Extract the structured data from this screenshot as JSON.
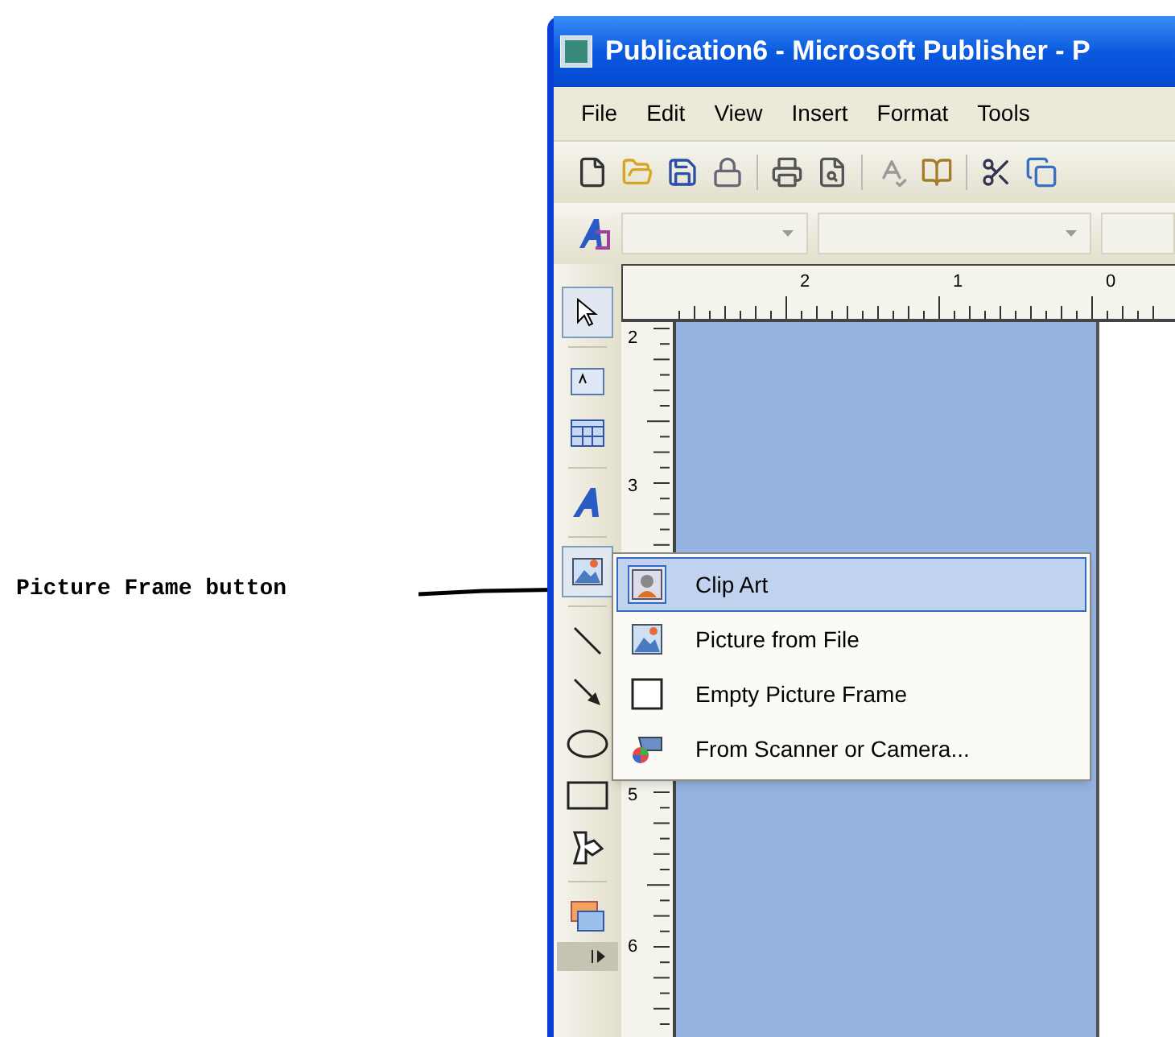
{
  "annotation": {
    "label": "Picture Frame button"
  },
  "window": {
    "title": "Publication6 - Microsoft Publisher - P"
  },
  "menu_bar": [
    "File",
    "Edit",
    "View",
    "Insert",
    "Format",
    "Tools"
  ],
  "standard_toolbar": [
    {
      "kind": "new"
    },
    {
      "kind": "open"
    },
    {
      "kind": "save"
    },
    {
      "kind": "permission"
    },
    {
      "kind": "print"
    },
    {
      "kind": "preview"
    },
    {
      "kind": "spelling"
    },
    {
      "kind": "research"
    },
    {
      "kind": "cut"
    },
    {
      "kind": "copy"
    }
  ],
  "horizontal_ruler": [
    "2",
    "1",
    "0"
  ],
  "vertical_ruler": [
    "2",
    "3",
    "5",
    "6"
  ],
  "objects_toolbar": [
    {
      "kind": "select",
      "pressed": true
    },
    {
      "kind": "textbox",
      "pressed": false
    },
    {
      "kind": "table",
      "pressed": false
    },
    {
      "kind": "wordart",
      "pressed": false
    },
    {
      "kind": "picture",
      "pressed": true
    },
    {
      "kind": "line",
      "pressed": false
    },
    {
      "kind": "arrow",
      "pressed": false
    },
    {
      "kind": "oval",
      "pressed": false
    },
    {
      "kind": "rectangle",
      "pressed": false
    },
    {
      "kind": "autoshapes",
      "pressed": false
    },
    {
      "kind": "gallery",
      "pressed": false
    },
    {
      "kind": "expand",
      "pressed": false
    }
  ],
  "picture_menu": [
    {
      "label": "Clip Art",
      "kind": "clipart",
      "selected": true
    },
    {
      "label": "Picture from File",
      "kind": "file",
      "selected": false
    },
    {
      "label": "Empty Picture Frame",
      "kind": "empty",
      "selected": false
    },
    {
      "label": "From Scanner or Camera...",
      "kind": "scanner",
      "selected": false
    }
  ]
}
